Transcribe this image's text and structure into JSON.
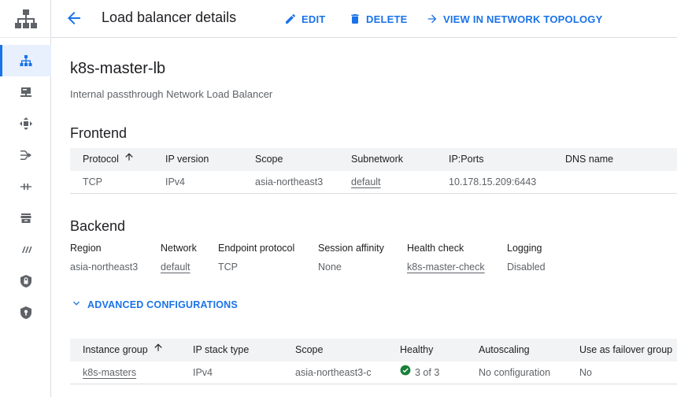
{
  "header": {
    "title": "Load balancer details",
    "edit_label": "EDIT",
    "delete_label": "DELETE",
    "topology_label": "VIEW IN NETWORK TOPOLOGY"
  },
  "rail": {
    "items": [
      {
        "icon": "load-balancer-icon",
        "active": true
      },
      {
        "icon": "server-icon"
      },
      {
        "icon": "routes-icon"
      },
      {
        "icon": "forwarding-icon"
      },
      {
        "icon": "interconnect-icon"
      },
      {
        "icon": "archive-icon"
      },
      {
        "icon": "traffic-icon"
      },
      {
        "icon": "lock-shield-icon"
      },
      {
        "icon": "security-shield-icon"
      }
    ]
  },
  "lb": {
    "name": "k8s-master-lb",
    "type": "Internal passthrough Network Load Balancer"
  },
  "frontend": {
    "title": "Frontend",
    "columns": [
      "Protocol",
      "IP version",
      "Scope",
      "Subnetwork",
      "IP:Ports",
      "DNS name"
    ],
    "row": {
      "protocol": "TCP",
      "ip_version": "IPv4",
      "scope": "asia-northeast3",
      "subnetwork": "default",
      "ip_ports": "10.178.15.209:6443",
      "dns_name": ""
    }
  },
  "backend": {
    "title": "Backend",
    "labels": {
      "region": "Region",
      "network": "Network",
      "endpoint_protocol": "Endpoint protocol",
      "session_affinity": "Session affinity",
      "health_check": "Health check",
      "logging": "Logging"
    },
    "values": {
      "region": "asia-northeast3",
      "network": "default",
      "endpoint_protocol": "TCP",
      "session_affinity": "None",
      "health_check": "k8s-master-check",
      "logging": "Disabled"
    },
    "advanced_label": "ADVANCED CONFIGURATIONS"
  },
  "instance_groups": {
    "columns": [
      "Instance group",
      "IP stack type",
      "Scope",
      "Healthy",
      "Autoscaling",
      "Use as failover group"
    ],
    "rows": [
      {
        "instance_group": "k8s-masters",
        "ip_stack_type": "IPv4",
        "scope": "asia-northeast3-c",
        "healthy": "3 of 3",
        "autoscaling": "No configuration",
        "failover": "No"
      }
    ]
  },
  "colors": {
    "accent": "#1a73e8",
    "healthy": "#188038",
    "icon_grey": "#5f6368"
  }
}
